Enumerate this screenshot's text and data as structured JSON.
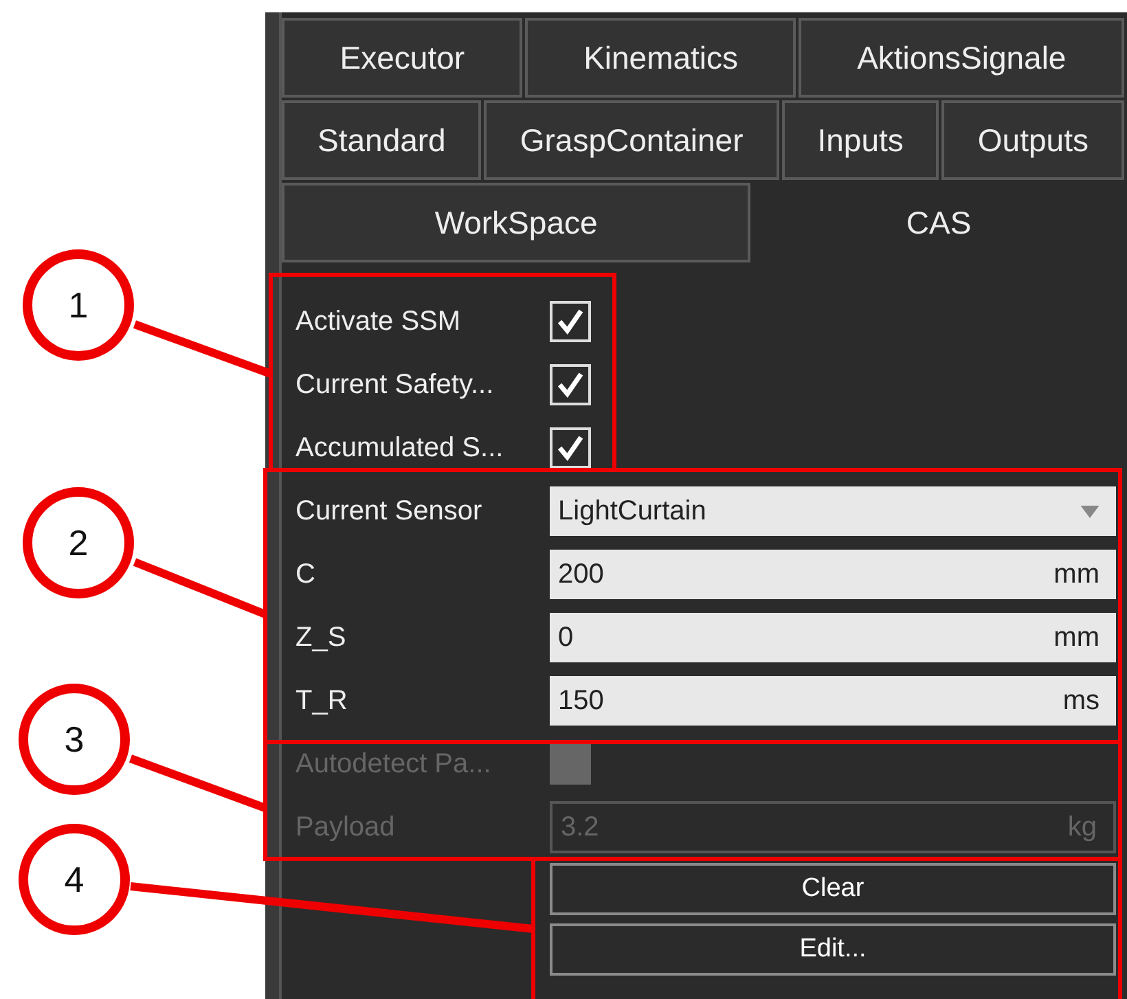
{
  "tab_rows": [
    [
      {
        "label": "Executor",
        "selected": false
      },
      {
        "label": "Kinematics",
        "selected": false
      },
      {
        "label": "AktionsSignale",
        "selected": false
      }
    ],
    [
      {
        "label": "Standard",
        "selected": false
      },
      {
        "label": "GraspContainer",
        "selected": false
      },
      {
        "label": "Inputs",
        "selected": false
      },
      {
        "label": "Outputs",
        "selected": false
      }
    ],
    [
      {
        "label": "WorkSpace",
        "selected": false
      },
      {
        "label": "CAS",
        "selected": true
      }
    ]
  ],
  "rows": [
    {
      "kind": "checkbox",
      "label": "Activate SSM",
      "checked": true,
      "disabled": false
    },
    {
      "kind": "checkbox",
      "label": "Current Safety...",
      "checked": true,
      "disabled": false
    },
    {
      "kind": "checkbox",
      "label": "Accumulated S...",
      "checked": true,
      "disabled": false
    },
    {
      "kind": "dropdown",
      "label": "Current Sensor",
      "value": "LightCurtain",
      "disabled": false
    },
    {
      "kind": "field",
      "label": "C",
      "value": "200",
      "unit": "mm",
      "disabled": false
    },
    {
      "kind": "field",
      "label": "Z_S",
      "value": "0",
      "unit": "mm",
      "disabled": false
    },
    {
      "kind": "field",
      "label": "T_R",
      "value": "150",
      "unit": "ms",
      "disabled": false
    },
    {
      "kind": "checkbox",
      "label": "Autodetect Pa...",
      "checked": false,
      "disabled": true
    },
    {
      "kind": "field",
      "label": "Payload",
      "value": "3.2",
      "unit": "kg",
      "disabled": true
    }
  ],
  "buttons": [
    "Clear",
    "Edit..."
  ],
  "callouts": [
    "1",
    "2",
    "3",
    "4"
  ]
}
